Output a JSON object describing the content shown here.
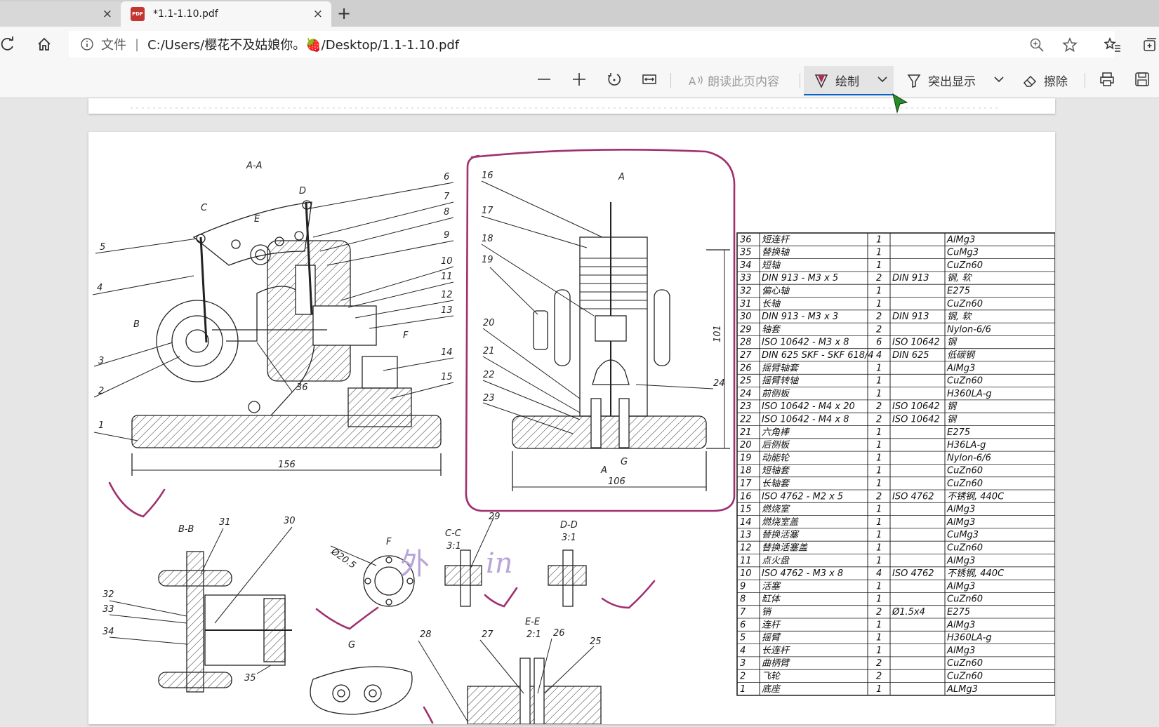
{
  "tabs": [
    {
      "label": "",
      "close": "×"
    },
    {
      "label": "*1.1-1.10.pdf",
      "close": "×",
      "icon": "pdf-icon",
      "icon_text": "PDF"
    }
  ],
  "new_tab": "+",
  "address": {
    "info_label": "文件",
    "separator": "|",
    "url": "C:/Users/樱花不及姑娘你。🍓/Desktop/1.1-1.10.pdf"
  },
  "toolbar": {
    "read_aloud": "朗读此页内容",
    "draw": "绘制",
    "highlight": "突出显示",
    "erase": "擦除"
  },
  "drawing": {
    "section_aa": "A-A",
    "section_bb": "B-B",
    "section_cc": "C-C",
    "scale_cc": "3:1",
    "section_dd": "D-D",
    "scale_dd": "3:1",
    "section_ee": "E-E",
    "scale_ee": "2:1",
    "view_f": "F",
    "view_g": "G",
    "dim_156": "156",
    "dim_106": "106",
    "dim_101": "101",
    "dim_dia": "Ø20.5",
    "label_b": "B",
    "label_c": "C",
    "label_d": "D",
    "label_e": "E",
    "label_a": "A",
    "label_f": "F",
    "label_g": "G",
    "callouts_left": [
      "5",
      "4",
      "3",
      "2",
      "1"
    ],
    "callouts_right": [
      "6",
      "7",
      "8",
      "9",
      "10",
      "11",
      "12",
      "13",
      "14",
      "15"
    ],
    "callouts_mid": [
      "16",
      "17",
      "18",
      "19",
      "20",
      "21",
      "22",
      "23",
      "24"
    ],
    "callout_36": "36",
    "callouts_bb": [
      "31",
      "30",
      "32",
      "33",
      "34",
      "35"
    ],
    "callout_29": "29",
    "callouts_ee": [
      "28",
      "27",
      "26",
      "25"
    ],
    "handwriting": [
      "外",
      "in"
    ]
  },
  "parts_table": [
    {
      "no": "36",
      "name": "短连杆",
      "qty": "1",
      "std": "",
      "mat": "AlMg3"
    },
    {
      "no": "35",
      "name": "替换轴",
      "qty": "1",
      "std": "",
      "mat": "CuMg3"
    },
    {
      "no": "34",
      "name": "短轴",
      "qty": "1",
      "std": "",
      "mat": "CuZn60"
    },
    {
      "no": "33",
      "name": "DIN 913 - M3 x 5",
      "qty": "2",
      "std": "DIN 913",
      "mat": "钢, 软"
    },
    {
      "no": "32",
      "name": "偏心轴",
      "qty": "1",
      "std": "",
      "mat": "E275"
    },
    {
      "no": "31",
      "name": "长轴",
      "qty": "1",
      "std": "",
      "mat": "CuZn60"
    },
    {
      "no": "30",
      "name": "DIN 913 - M3 x 3",
      "qty": "2",
      "std": "DIN 913",
      "mat": "钢, 软"
    },
    {
      "no": "29",
      "name": "轴套",
      "qty": "2",
      "std": "",
      "mat": "Nylon-6/6"
    },
    {
      "no": "28",
      "name": "ISO 10642 - M3 x 8",
      "qty": "6",
      "std": "ISO 10642",
      "mat": "钢"
    },
    {
      "no": "27",
      "name": "DIN 625 SKF - SKF 618/4",
      "qty": "4",
      "std": "DIN 625",
      "mat": "低碳钢"
    },
    {
      "no": "26",
      "name": "摇臂轴套",
      "qty": "1",
      "std": "",
      "mat": "AlMg3"
    },
    {
      "no": "25",
      "name": "摇臂转轴",
      "qty": "1",
      "std": "",
      "mat": "CuZn60"
    },
    {
      "no": "24",
      "name": "前侧板",
      "qty": "1",
      "std": "",
      "mat": "H360LA-g"
    },
    {
      "no": "23",
      "name": "ISO 10642 - M4 x 20",
      "qty": "2",
      "std": "ISO 10642",
      "mat": "钢"
    },
    {
      "no": "22",
      "name": "ISO 10642 - M4 x 8",
      "qty": "2",
      "std": "ISO 10642",
      "mat": "钢"
    },
    {
      "no": "21",
      "name": "六角棒",
      "qty": "1",
      "std": "",
      "mat": "E275"
    },
    {
      "no": "20",
      "name": "后侧板",
      "qty": "1",
      "std": "",
      "mat": "H36LA-g"
    },
    {
      "no": "19",
      "name": "动能轮",
      "qty": "1",
      "std": "",
      "mat": "Nylon-6/6"
    },
    {
      "no": "18",
      "name": "短轴套",
      "qty": "1",
      "std": "",
      "mat": "CuZn60"
    },
    {
      "no": "17",
      "name": "长轴套",
      "qty": "1",
      "std": "",
      "mat": "CuZn60"
    },
    {
      "no": "16",
      "name": "ISO 4762 - M2 x 5",
      "qty": "2",
      "std": "ISO 4762",
      "mat": "不锈钢, 440C"
    },
    {
      "no": "15",
      "name": "燃烧室",
      "qty": "1",
      "std": "",
      "mat": "AlMg3"
    },
    {
      "no": "14",
      "name": "燃烧室盖",
      "qty": "1",
      "std": "",
      "mat": "AlMg3"
    },
    {
      "no": "13",
      "name": "替换活塞",
      "qty": "1",
      "std": "",
      "mat": "CuMg3"
    },
    {
      "no": "12",
      "name": "替换活塞盖",
      "qty": "1",
      "std": "",
      "mat": "CuZn60"
    },
    {
      "no": "11",
      "name": "点火盘",
      "qty": "1",
      "std": "",
      "mat": "AlMg3"
    },
    {
      "no": "10",
      "name": "ISO 4762 - M3 x 8",
      "qty": "4",
      "std": "ISO 4762",
      "mat": "不锈钢, 440C"
    },
    {
      "no": "9",
      "name": "活塞",
      "qty": "1",
      "std": "",
      "mat": "AlMg3"
    },
    {
      "no": "8",
      "name": "缸体",
      "qty": "1",
      "std": "",
      "mat": "CuZn60"
    },
    {
      "no": "7",
      "name": "销",
      "qty": "2",
      "std": "Ø1.5x4",
      "mat": "E275"
    },
    {
      "no": "6",
      "name": "连杆",
      "qty": "1",
      "std": "",
      "mat": "AlMg3"
    },
    {
      "no": "5",
      "name": "摇臂",
      "qty": "1",
      "std": "",
      "mat": "H360LA-g"
    },
    {
      "no": "4",
      "name": "长连杆",
      "qty": "1",
      "std": "",
      "mat": "AlMg3"
    },
    {
      "no": "3",
      "name": "曲柄臂",
      "qty": "2",
      "std": "",
      "mat": "CuZn60"
    },
    {
      "no": "2",
      "name": "飞轮",
      "qty": "2",
      "std": "",
      "mat": "CuZn60"
    },
    {
      "no": "1",
      "name": "底座",
      "qty": "1",
      "std": "",
      "mat": "ALMg3"
    }
  ],
  "annotation_color": "#a0306e",
  "handwriting_color": "#b9a6d8",
  "accent_color": "#0a64c8"
}
